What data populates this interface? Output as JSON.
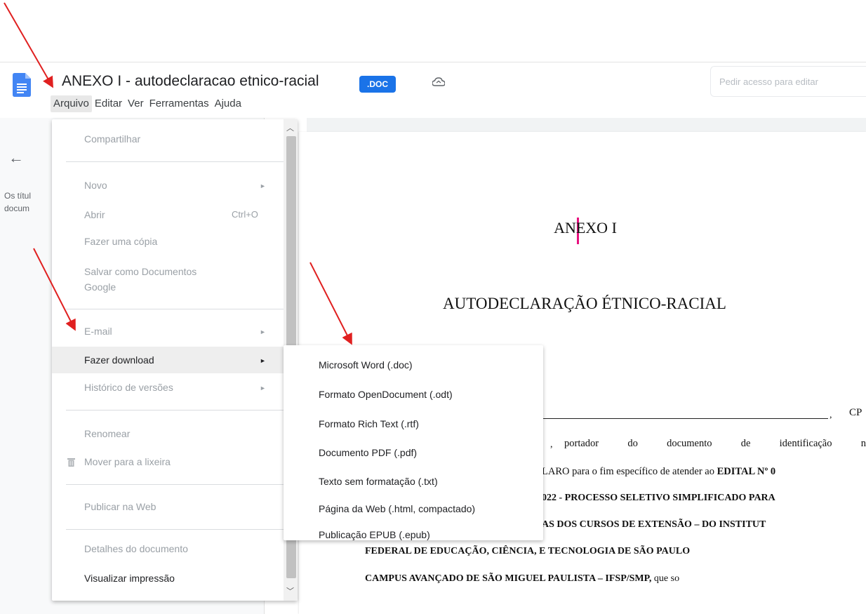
{
  "header": {
    "title": "ANEXO I - autodeclaracao etnico-racial",
    "badge": ".DOC",
    "access_button": "Pedir acesso para editar"
  },
  "menubar": [
    "Arquivo",
    "Editar",
    "Ver",
    "Ferramentas",
    "Ajuda"
  ],
  "outline": {
    "line1": "Os títul",
    "line2": "docum"
  },
  "file_menu": {
    "share": "Compartilhar",
    "new": "Novo",
    "open": "Abrir",
    "open_shortcut": "Ctrl+O",
    "copy": "Fazer uma cópia",
    "save_as_line1": "Salvar como Documentos",
    "save_as_line2": "Google",
    "email": "E-mail",
    "download": "Fazer download",
    "versions": "Histórico de versões",
    "rename": "Renomear",
    "trash": "Mover para a lixeira",
    "publish": "Publicar na Web",
    "details": "Detalhes do documento",
    "print_preview": "Visualizar impressão"
  },
  "download_submenu": [
    "Microsoft Word (.doc)",
    "Formato OpenDocument (.odt)",
    "Formato Rich Text (.rtf)",
    "Documento PDF (.pdf)",
    "Texto sem formatação (.txt)",
    "Página da Web (.html, compactado)",
    "Publicação EPUB (.epub)"
  ],
  "document": {
    "heading1": "ANEXO I",
    "heading2": "AUTODECLARAÇÃO ÉTNICO-RACIAL",
    "cpf_tail": "CP",
    "line1_a": "portador",
    "line1_b": "do",
    "line1_c": "documento",
    "line1_d": "de",
    "line1_e": "identificação",
    "line1_f": "n",
    "line2_a": "LARO para o fim específico de atender ao ",
    "line2_b": "EDITAL Nº 0",
    "line3": "022 - PROCESSO SELETIVO SIMPLIFICADO PARA",
    "line4": "AS DOS CURSOS DE EXTENSÃO – DO INSTITUT",
    "line5": "FEDERAL DE EDUCAÇÃO, CIÊNCIA, E TECNOLOGIA  DE SÃO PAULO",
    "line6_a": "CAMPUS AVANÇADO DE SÃO MIGUEL PAULISTA – IFSP/SMP,",
    "line6_b": "que so"
  },
  "colors": {
    "brand_blue": "#1a73e8",
    "annotation_red": "#e02020",
    "cursor_pink": "#e8117f"
  }
}
